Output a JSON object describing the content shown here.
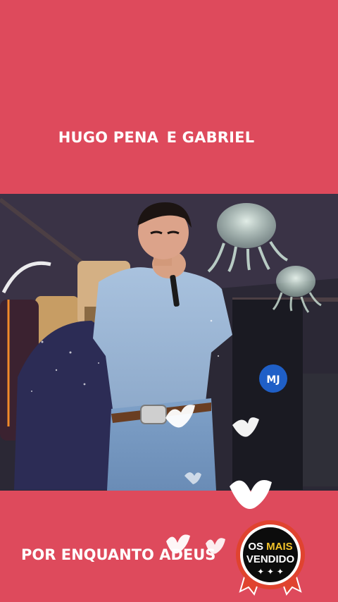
{
  "header": {
    "title_part1": "HUGO PENA",
    "title_part2": "E GABRIEL"
  },
  "video": {
    "content": "singer-performing-on-stage",
    "stage_logo_text": "MJ"
  },
  "footer": {
    "song_title": "POR ENQUANTO ADEUS"
  },
  "badge": {
    "line1_a": "OS",
    "line1_b": "MAIS",
    "line2": "VENDIDO",
    "star": "✦ ✦ ✦"
  },
  "colors": {
    "background": "#de4a5c",
    "badge_accent": "#f3c32a",
    "badge_ribbon": "#e0432f"
  }
}
